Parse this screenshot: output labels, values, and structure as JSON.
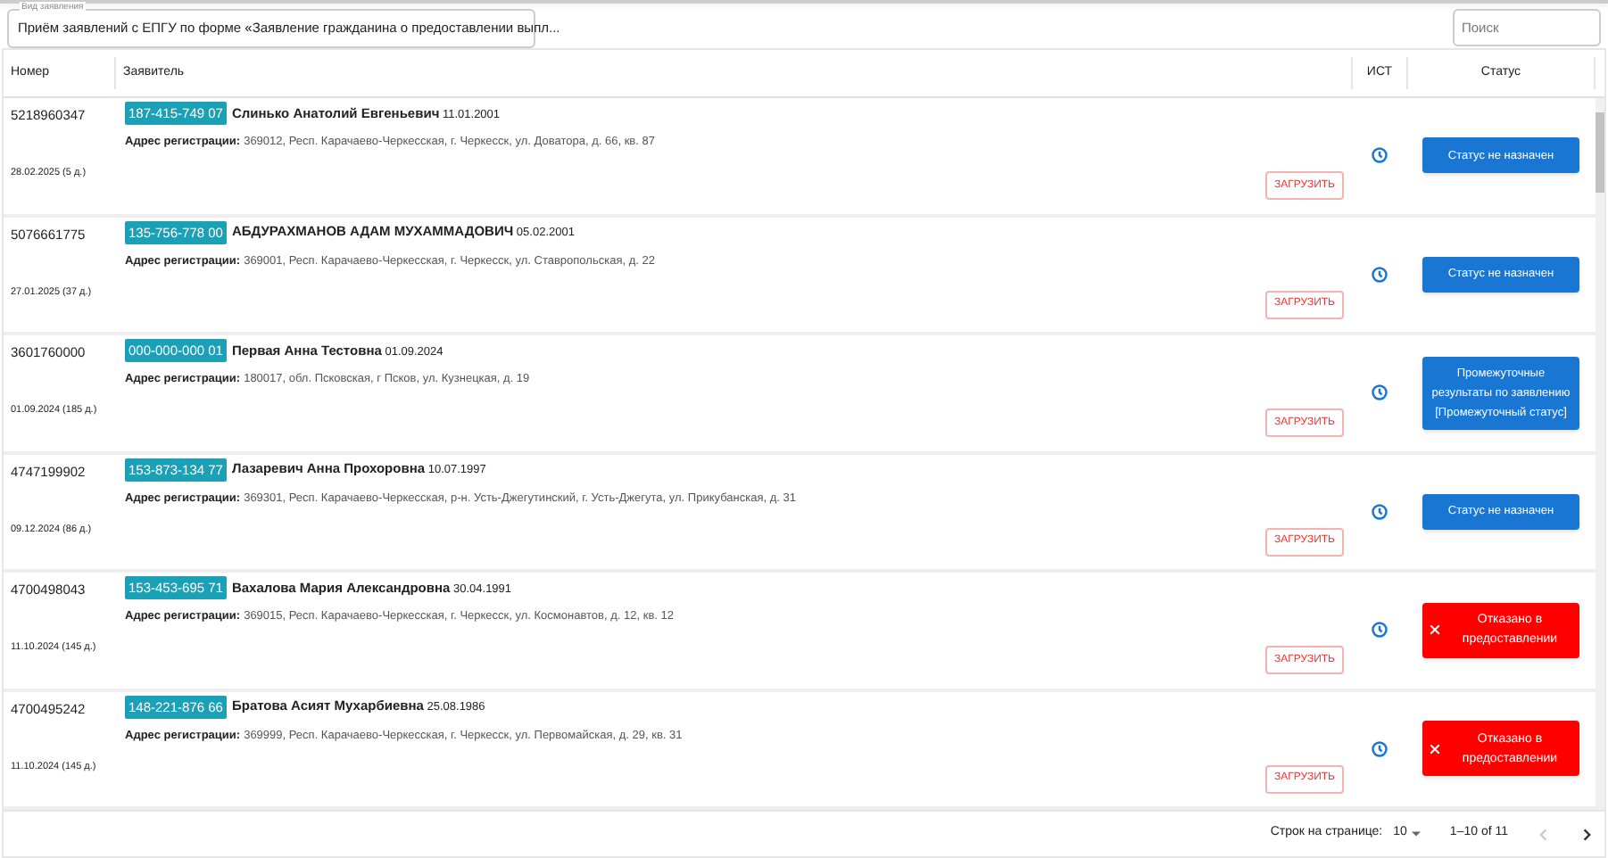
{
  "filter": {
    "label": "Вид заявления",
    "value": "Приём заявлений с ЕПГУ по форме «Заявление гражданина о предоставлении выпл..."
  },
  "search": {
    "placeholder": "Поиск"
  },
  "table": {
    "columns": [
      "Номер",
      "Заявитель",
      "ИСТ",
      "Статус"
    ],
    "rows": [
      {
        "number": "5218960347",
        "date": "28.02.2025 (5 д.)",
        "snils": "187-415-749 07",
        "applicant": "**Слинько Анатолий Евгеньевич** 11.01.2001",
        "address_label": "Адрес регистрации:",
        "address": "369012, Респ. Карачаево-Черкесская, г. Черкесск, ул. Доватора, д. 66, кв. 87",
        "upload": "ЗАГРУЗИТЬ",
        "status": {
          "kind": "info",
          "text": "Статус не назначен"
        }
      },
      {
        "number": "5076661775",
        "date": "27.01.2025 (37 д.)",
        "snils": "135-756-778 00",
        "applicant": "**АБДУРАХМАНОВ АДАМ МУХАММАДОВИЧ** 05.02.2001",
        "address_label": "Адрес регистрации:",
        "address": "369001, Респ. Карачаево-Черкесская, г. Черкесск, ул. Ставропольская, д. 22",
        "upload": "ЗАГРУЗИТЬ",
        "status": {
          "kind": "info",
          "text": "Статус не назначен"
        }
      },
      {
        "number": "3601760000",
        "date": "01.09.2024 (185 д.)",
        "snils": "000-000-000 01",
        "applicant": "**Первая Анна Тестовна** 01.09.2024",
        "address_label": "Адрес регистрации:",
        "address": "180017, обл. Псковская, г Псков, ул. Кузнецкая, д. 19",
        "upload": "ЗАГРУЗИТЬ",
        "status": {
          "kind": "info",
          "text": "Промежуточные результаты по заявлению [Промежуточный статус]"
        }
      },
      {
        "number": "4747199902",
        "date": "09.12.2024 (86 д.)",
        "snils": "153-873-134 77",
        "applicant": "**Лазаревич Анна Прохоровна** 10.07.1997",
        "address_label": "Адрес регистрации:",
        "address": "369301, Респ. Карачаево-Черкесская, р-н. Усть-Джегутинский, г. Усть-Джегута, ул. Прикубанская, д. 31",
        "upload": "ЗАГРУЗИТЬ",
        "status": {
          "kind": "info",
          "text": "Статус не назначен"
        }
      },
      {
        "number": "4700498043",
        "date": "11.10.2024 (145 д.)",
        "snils": "153-453-695 71",
        "applicant": "**Вахалова Мария Александровна** 30.04.1991",
        "address_label": "Адрес регистрации:",
        "address": "369015, Респ. Карачаево-Черкесская, г. Черкесск, ул. Космонавтов, д. 12, кв. 12",
        "upload": "ЗАГРУЗИТЬ",
        "status": {
          "kind": "refused",
          "text": "Отказано в предоставлении"
        }
      },
      {
        "number": "4700495242",
        "date": "11.10.2024 (145 д.)",
        "snils": "148-221-876 66",
        "applicant": "**Братова Асият Мухарбиевна** 25.08.1986",
        "address_label": "Адрес регистрации:",
        "address": "369999, Респ. Карачаево-Черкесская, г. Черкесск, ул. Первомайская, д. 29, кв. 31",
        "upload": "ЗАГРУЗИТЬ",
        "status": {
          "kind": "refused",
          "text": "Отказано в предоставлении"
        }
      }
    ]
  },
  "pagination": {
    "rows_label": "Строк на странице:",
    "rows_value": "10",
    "range": "1–10 of 11",
    "prev_disabled": true,
    "next_disabled": false
  }
}
